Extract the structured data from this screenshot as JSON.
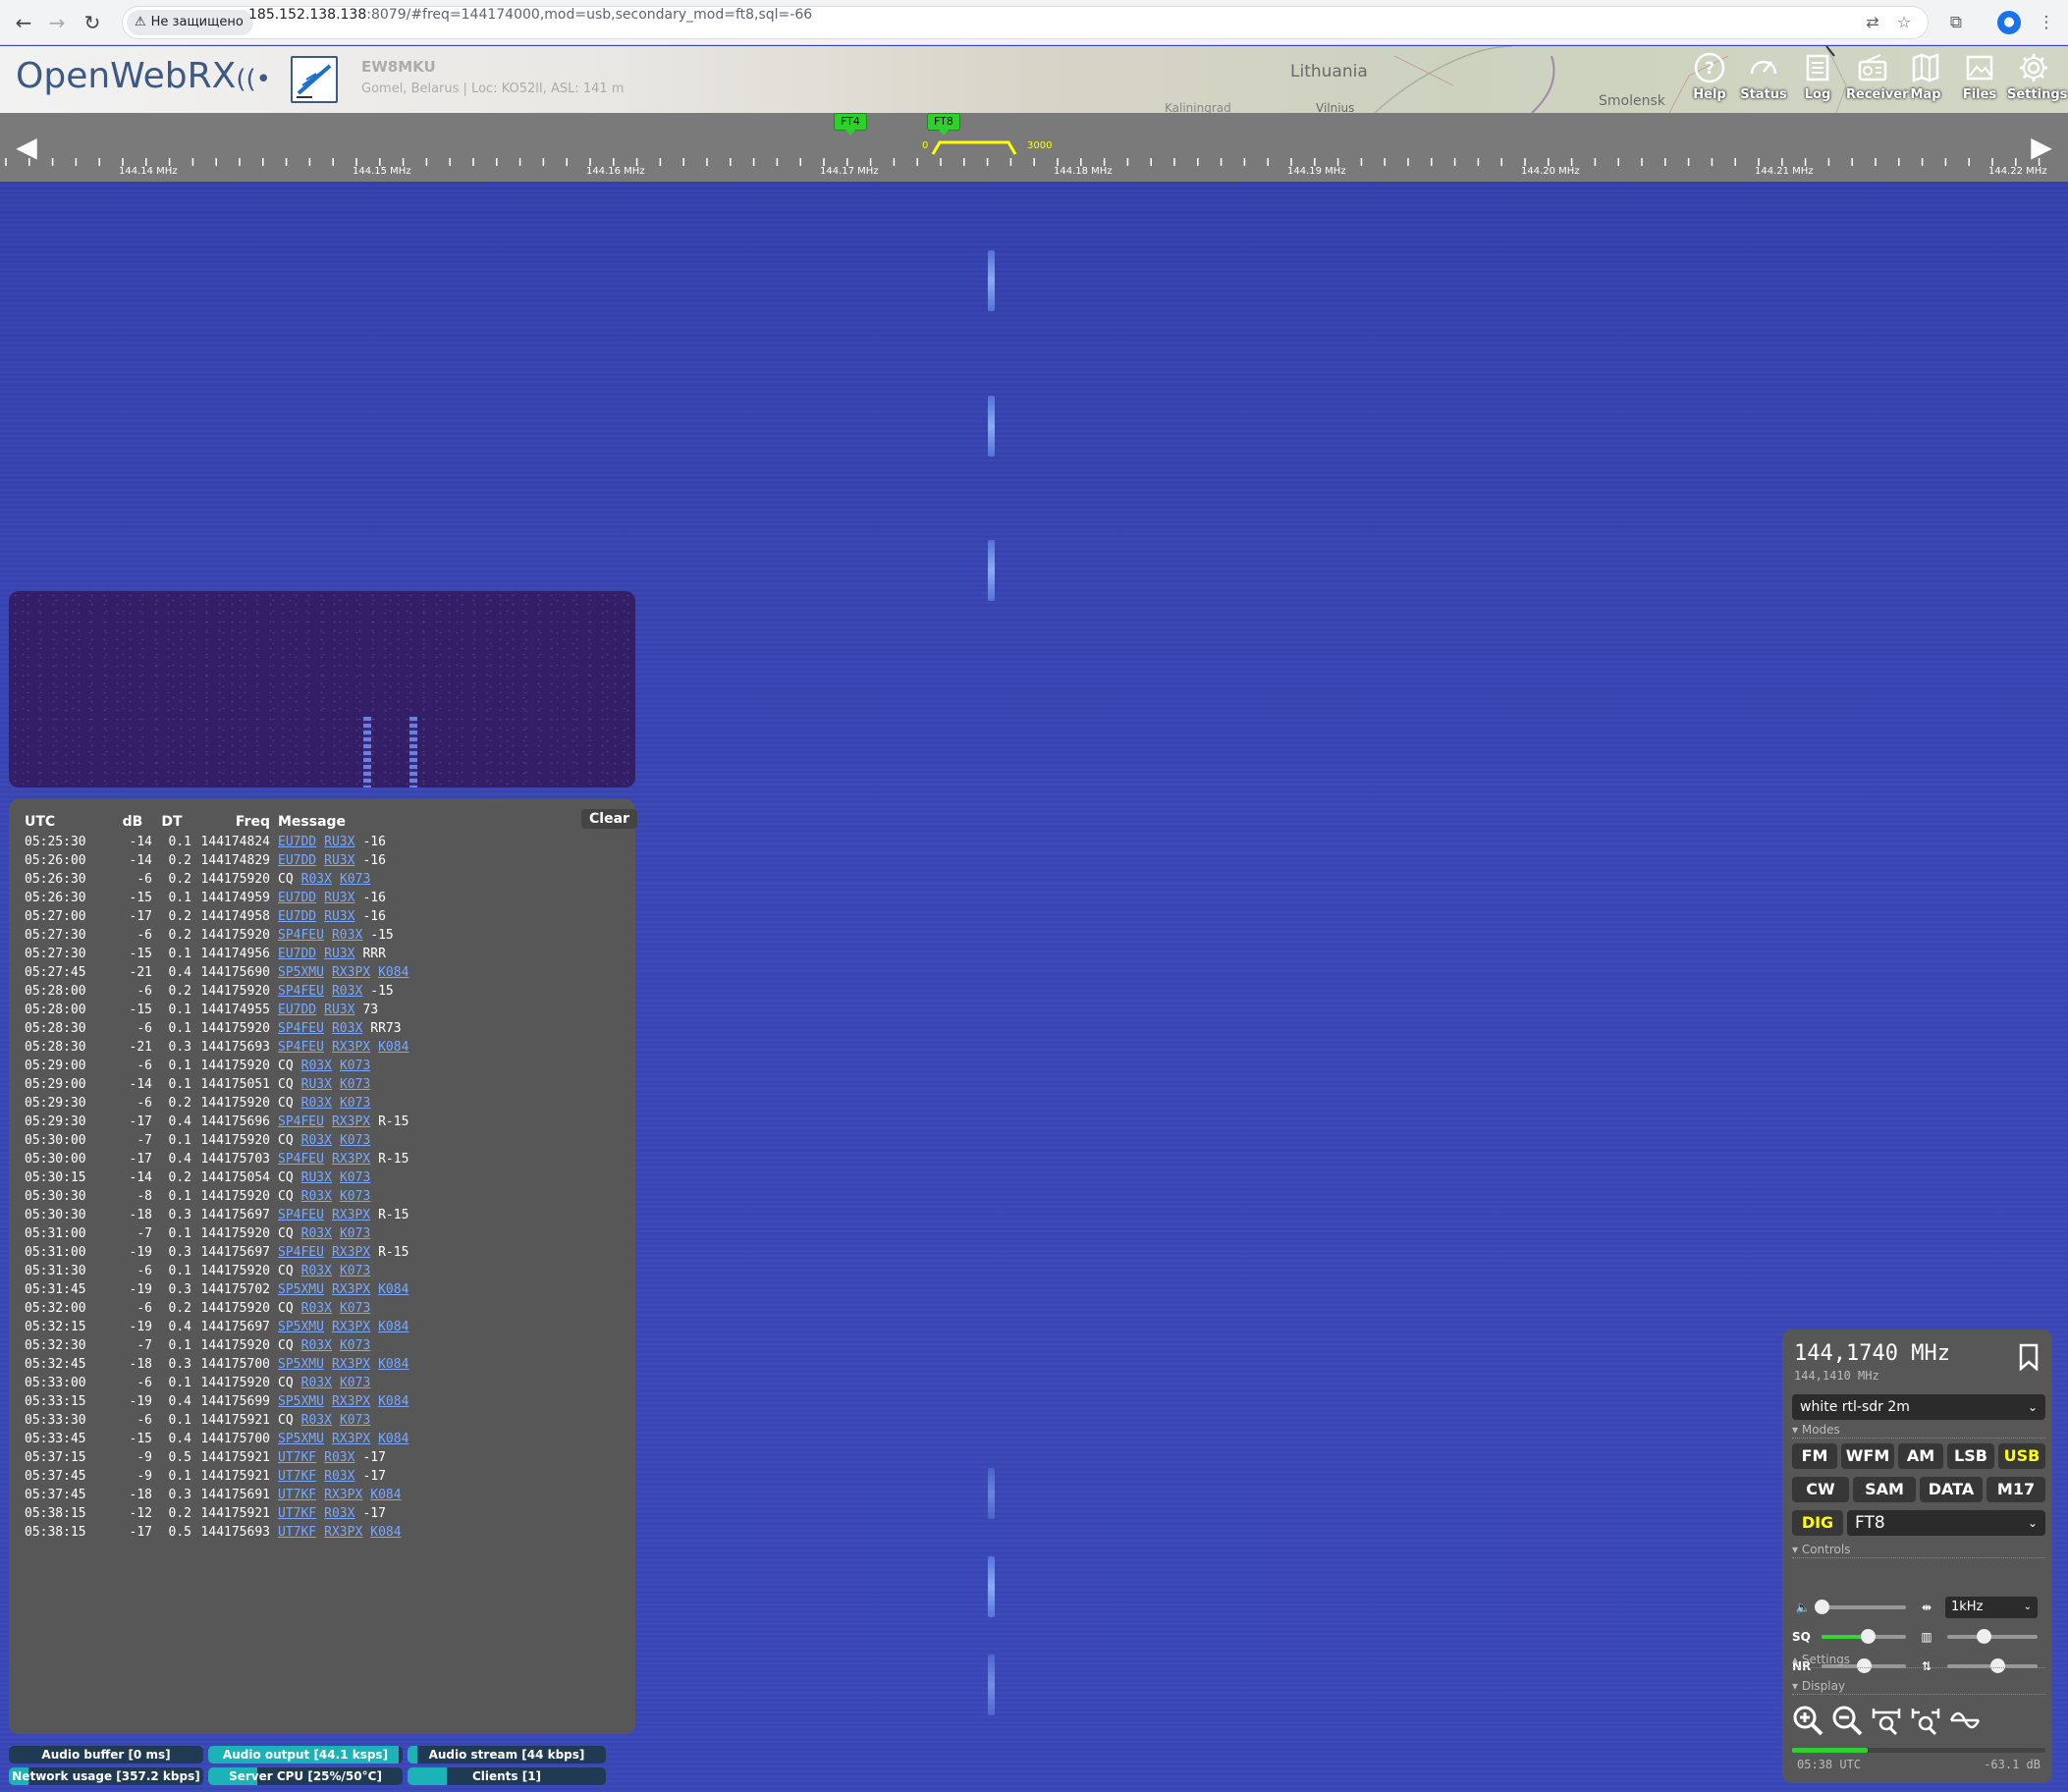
{
  "browser": {
    "security_label": "Не защищено",
    "url_host": "185.152.138.138",
    "url_rest": ":8079/#freq=144174000,mod=usb,secondary_mod=ft8,sql=-66"
  },
  "header": {
    "logo_text": "OpenWebRX",
    "logo_rx": "RX",
    "callsign": "EW8MKU",
    "location": "Gomel, Belarus | Loc: KO52lI, ASL: 141 m",
    "map_labels": [
      "Lithuania",
      "Smolensk",
      "Vilnius",
      "Kaliningrad"
    ],
    "buttons": [
      {
        "name": "help",
        "label": "Help",
        "icon": "help-icon"
      },
      {
        "name": "status",
        "label": "Status",
        "icon": "gauge-icon"
      },
      {
        "name": "log",
        "label": "Log",
        "icon": "log-icon"
      },
      {
        "name": "receiver",
        "label": "Receiver",
        "icon": "radio-icon"
      },
      {
        "name": "map",
        "label": "Map",
        "icon": "map-icon"
      },
      {
        "name": "files",
        "label": "Files",
        "icon": "image-icon"
      },
      {
        "name": "settings",
        "label": "Settings",
        "icon": "gear-icon"
      }
    ]
  },
  "scale": {
    "labels": [
      "144.14 MHz",
      "144.15 MHz",
      "144.16 MHz",
      "144.17 MHz",
      "144.18 MHz",
      "144.19 MHz",
      "144.20 MHz",
      "144.21 MHz",
      "144.22 MHz"
    ],
    "bookmarks": [
      "FT4",
      "FT8"
    ],
    "bw_low": "0",
    "bw_high": "3000",
    "colors": {
      "bookmark": "#2cd12c",
      "passband": "#ffff00"
    }
  },
  "log": {
    "clear_label": "Clear",
    "headers": {
      "utc": "UTC",
      "db": "dB",
      "dt": "DT",
      "freq": "Freq",
      "message": "Message"
    },
    "rows": [
      {
        "utc": "05:25:30",
        "db": "-14",
        "dt": "0.1",
        "freq": "144174824",
        "msg": [
          {
            "t": "EU7DD",
            "l": true
          },
          {
            "t": "RU3X",
            "l": true
          },
          {
            "t": "-16",
            "l": false
          }
        ]
      },
      {
        "utc": "05:26:00",
        "db": "-14",
        "dt": "0.2",
        "freq": "144174829",
        "msg": [
          {
            "t": "EU7DD",
            "l": true
          },
          {
            "t": "RU3X",
            "l": true
          },
          {
            "t": "-16",
            "l": false
          }
        ]
      },
      {
        "utc": "05:26:30",
        "db": "-6",
        "dt": "0.2",
        "freq": "144175920",
        "msg": [
          {
            "t": "CQ",
            "l": false
          },
          {
            "t": "R03X",
            "l": true
          },
          {
            "t": "K073",
            "l": true
          }
        ]
      },
      {
        "utc": "05:26:30",
        "db": "-15",
        "dt": "0.1",
        "freq": "144174959",
        "msg": [
          {
            "t": "EU7DD",
            "l": true
          },
          {
            "t": "RU3X",
            "l": true
          },
          {
            "t": "-16",
            "l": false
          }
        ]
      },
      {
        "utc": "05:27:00",
        "db": "-17",
        "dt": "0.2",
        "freq": "144174958",
        "msg": [
          {
            "t": "EU7DD",
            "l": true
          },
          {
            "t": "RU3X",
            "l": true
          },
          {
            "t": "-16",
            "l": false
          }
        ]
      },
      {
        "utc": "05:27:30",
        "db": "-6",
        "dt": "0.2",
        "freq": "144175920",
        "msg": [
          {
            "t": "SP4FEU",
            "l": true
          },
          {
            "t": "R03X",
            "l": true
          },
          {
            "t": "-15",
            "l": false
          }
        ]
      },
      {
        "utc": "05:27:30",
        "db": "-15",
        "dt": "0.1",
        "freq": "144174956",
        "msg": [
          {
            "t": "EU7DD",
            "l": true
          },
          {
            "t": "RU3X",
            "l": true
          },
          {
            "t": "RRR",
            "l": false
          }
        ]
      },
      {
        "utc": "05:27:45",
        "db": "-21",
        "dt": "0.4",
        "freq": "144175690",
        "msg": [
          {
            "t": "SP5XMU",
            "l": true
          },
          {
            "t": "RX3PX",
            "l": true
          },
          {
            "t": "K084",
            "l": true
          }
        ]
      },
      {
        "utc": "05:28:00",
        "db": "-6",
        "dt": "0.2",
        "freq": "144175920",
        "msg": [
          {
            "t": "SP4FEU",
            "l": true
          },
          {
            "t": "R03X",
            "l": true
          },
          {
            "t": "-15",
            "l": false
          }
        ]
      },
      {
        "utc": "05:28:00",
        "db": "-15",
        "dt": "0.1",
        "freq": "144174955",
        "msg": [
          {
            "t": "EU7DD",
            "l": true
          },
          {
            "t": "RU3X",
            "l": true
          },
          {
            "t": "73",
            "l": false
          }
        ]
      },
      {
        "utc": "05:28:30",
        "db": "-6",
        "dt": "0.1",
        "freq": "144175920",
        "msg": [
          {
            "t": "SP4FEU",
            "l": true
          },
          {
            "t": "R03X",
            "l": true
          },
          {
            "t": "RR73",
            "l": false
          }
        ]
      },
      {
        "utc": "05:28:30",
        "db": "-21",
        "dt": "0.3",
        "freq": "144175693",
        "msg": [
          {
            "t": "SP4FEU",
            "l": true
          },
          {
            "t": "RX3PX",
            "l": true
          },
          {
            "t": "K084",
            "l": true
          }
        ]
      },
      {
        "utc": "05:29:00",
        "db": "-6",
        "dt": "0.1",
        "freq": "144175920",
        "msg": [
          {
            "t": "CQ",
            "l": false
          },
          {
            "t": "R03X",
            "l": true
          },
          {
            "t": "K073",
            "l": true
          }
        ]
      },
      {
        "utc": "05:29:00",
        "db": "-14",
        "dt": "0.1",
        "freq": "144175051",
        "msg": [
          {
            "t": "CQ",
            "l": false
          },
          {
            "t": "RU3X",
            "l": true
          },
          {
            "t": "K073",
            "l": true
          }
        ]
      },
      {
        "utc": "05:29:30",
        "db": "-6",
        "dt": "0.2",
        "freq": "144175920",
        "msg": [
          {
            "t": "CQ",
            "l": false
          },
          {
            "t": "R03X",
            "l": true
          },
          {
            "t": "K073",
            "l": true
          }
        ]
      },
      {
        "utc": "05:29:30",
        "db": "-17",
        "dt": "0.4",
        "freq": "144175696",
        "msg": [
          {
            "t": "SP4FEU",
            "l": true
          },
          {
            "t": "RX3PX",
            "l": true
          },
          {
            "t": "R-15",
            "l": false
          }
        ]
      },
      {
        "utc": "05:30:00",
        "db": "-7",
        "dt": "0.1",
        "freq": "144175920",
        "msg": [
          {
            "t": "CQ",
            "l": false
          },
          {
            "t": "R03X",
            "l": true
          },
          {
            "t": "K073",
            "l": true
          }
        ]
      },
      {
        "utc": "05:30:00",
        "db": "-17",
        "dt": "0.4",
        "freq": "144175703",
        "msg": [
          {
            "t": "SP4FEU",
            "l": true
          },
          {
            "t": "RX3PX",
            "l": true
          },
          {
            "t": "R-15",
            "l": false
          }
        ]
      },
      {
        "utc": "05:30:15",
        "db": "-14",
        "dt": "0.2",
        "freq": "144175054",
        "msg": [
          {
            "t": "CQ",
            "l": false
          },
          {
            "t": "RU3X",
            "l": true
          },
          {
            "t": "K073",
            "l": true
          }
        ]
      },
      {
        "utc": "05:30:30",
        "db": "-8",
        "dt": "0.1",
        "freq": "144175920",
        "msg": [
          {
            "t": "CQ",
            "l": false
          },
          {
            "t": "R03X",
            "l": true
          },
          {
            "t": "K073",
            "l": true
          }
        ]
      },
      {
        "utc": "05:30:30",
        "db": "-18",
        "dt": "0.3",
        "freq": "144175697",
        "msg": [
          {
            "t": "SP4FEU",
            "l": true
          },
          {
            "t": "RX3PX",
            "l": true
          },
          {
            "t": "R-15",
            "l": false
          }
        ]
      },
      {
        "utc": "05:31:00",
        "db": "-7",
        "dt": "0.1",
        "freq": "144175920",
        "msg": [
          {
            "t": "CQ",
            "l": false
          },
          {
            "t": "R03X",
            "l": true
          },
          {
            "t": "K073",
            "l": true
          }
        ]
      },
      {
        "utc": "05:31:00",
        "db": "-19",
        "dt": "0.3",
        "freq": "144175697",
        "msg": [
          {
            "t": "SP4FEU",
            "l": true
          },
          {
            "t": "RX3PX",
            "l": true
          },
          {
            "t": "R-15",
            "l": false
          }
        ]
      },
      {
        "utc": "05:31:30",
        "db": "-6",
        "dt": "0.1",
        "freq": "144175920",
        "msg": [
          {
            "t": "CQ",
            "l": false
          },
          {
            "t": "R03X",
            "l": true
          },
          {
            "t": "K073",
            "l": true
          }
        ]
      },
      {
        "utc": "05:31:45",
        "db": "-19",
        "dt": "0.3",
        "freq": "144175702",
        "msg": [
          {
            "t": "SP5XMU",
            "l": true
          },
          {
            "t": "RX3PX",
            "l": true
          },
          {
            "t": "K084",
            "l": true
          }
        ]
      },
      {
        "utc": "05:32:00",
        "db": "-6",
        "dt": "0.2",
        "freq": "144175920",
        "msg": [
          {
            "t": "CQ",
            "l": false
          },
          {
            "t": "R03X",
            "l": true
          },
          {
            "t": "K073",
            "l": true
          }
        ]
      },
      {
        "utc": "05:32:15",
        "db": "-19",
        "dt": "0.4",
        "freq": "144175697",
        "msg": [
          {
            "t": "SP5XMU",
            "l": true
          },
          {
            "t": "RX3PX",
            "l": true
          },
          {
            "t": "K084",
            "l": true
          }
        ]
      },
      {
        "utc": "05:32:30",
        "db": "-7",
        "dt": "0.1",
        "freq": "144175920",
        "msg": [
          {
            "t": "CQ",
            "l": false
          },
          {
            "t": "R03X",
            "l": true
          },
          {
            "t": "K073",
            "l": true
          }
        ]
      },
      {
        "utc": "05:32:45",
        "db": "-18",
        "dt": "0.3",
        "freq": "144175700",
        "msg": [
          {
            "t": "SP5XMU",
            "l": true
          },
          {
            "t": "RX3PX",
            "l": true
          },
          {
            "t": "K084",
            "l": true
          }
        ]
      },
      {
        "utc": "05:33:00",
        "db": "-6",
        "dt": "0.1",
        "freq": "144175920",
        "msg": [
          {
            "t": "CQ",
            "l": false
          },
          {
            "t": "R03X",
            "l": true
          },
          {
            "t": "K073",
            "l": true
          }
        ]
      },
      {
        "utc": "05:33:15",
        "db": "-19",
        "dt": "0.4",
        "freq": "144175699",
        "msg": [
          {
            "t": "SP5XMU",
            "l": true
          },
          {
            "t": "RX3PX",
            "l": true
          },
          {
            "t": "K084",
            "l": true
          }
        ]
      },
      {
        "utc": "05:33:30",
        "db": "-6",
        "dt": "0.1",
        "freq": "144175921",
        "msg": [
          {
            "t": "CQ",
            "l": false
          },
          {
            "t": "R03X",
            "l": true
          },
          {
            "t": "K073",
            "l": true
          }
        ]
      },
      {
        "utc": "05:33:45",
        "db": "-15",
        "dt": "0.4",
        "freq": "144175700",
        "msg": [
          {
            "t": "SP5XMU",
            "l": true
          },
          {
            "t": "RX3PX",
            "l": true
          },
          {
            "t": "K084",
            "l": true
          }
        ]
      },
      {
        "utc": "05:37:15",
        "db": "-9",
        "dt": "0.5",
        "freq": "144175921",
        "msg": [
          {
            "t": "UT7KF",
            "l": true
          },
          {
            "t": "R03X",
            "l": true
          },
          {
            "t": "-17",
            "l": false
          }
        ]
      },
      {
        "utc": "05:37:45",
        "db": "-9",
        "dt": "0.1",
        "freq": "144175921",
        "msg": [
          {
            "t": "UT7KF",
            "l": true
          },
          {
            "t": "R03X",
            "l": true
          },
          {
            "t": "-17",
            "l": false
          }
        ]
      },
      {
        "utc": "05:37:45",
        "db": "-18",
        "dt": "0.3",
        "freq": "144175691",
        "msg": [
          {
            "t": "UT7KF",
            "l": true
          },
          {
            "t": "RX3PX",
            "l": true
          },
          {
            "t": "K084",
            "l": true
          }
        ]
      },
      {
        "utc": "05:38:15",
        "db": "-12",
        "dt": "0.2",
        "freq": "144175921",
        "msg": [
          {
            "t": "UT7KF",
            "l": true
          },
          {
            "t": "R03X",
            "l": true
          },
          {
            "t": "-17",
            "l": false
          }
        ]
      },
      {
        "utc": "05:38:15",
        "db": "-17",
        "dt": "0.5",
        "freq": "144175693",
        "msg": [
          {
            "t": "UT7KF",
            "l": true
          },
          {
            "t": "RX3PX",
            "l": true
          },
          {
            "t": "K084",
            "l": true
          }
        ]
      }
    ]
  },
  "status_bars": {
    "audio_buffer": {
      "label": "Audio buffer [0 ms]",
      "level": 0.0
    },
    "audio_output": {
      "label": "Audio output [44.1 ksps]",
      "level": 0.98
    },
    "audio_stream": {
      "label": "Audio stream [44 kbps]",
      "level": 0.05
    },
    "network": {
      "label": "Network usage [357.2 kbps]",
      "level": 0.1
    },
    "server_cpu": {
      "label": "Server CPU [25%/50°C]",
      "level": 0.25
    },
    "clients": {
      "label": "Clients [1]",
      "level": 0.2
    }
  },
  "receiver": {
    "frequency": "144,1740 MHz",
    "center_frequency": "144,1410 MHz",
    "profile": "white rtl-sdr 2m",
    "sections": {
      "modes": "▾ Modes",
      "controls": "▾ Controls",
      "settings": "▴ Settings",
      "display": "▾ Display"
    },
    "modes_row1": [
      "FM",
      "WFM",
      "AM",
      "LSB",
      "USB"
    ],
    "modes_row2": [
      "CW",
      "SAM",
      "DATA",
      "M17"
    ],
    "active_mode": "USB",
    "dig_label": "DIG",
    "dig_mode": "FT8",
    "step": "1kHz",
    "sq_label": "SQ",
    "nr_label": "NR",
    "volume_level": 0.0,
    "squelch_level": 0.55,
    "nr_level": 0.5,
    "gain_level": 0.4,
    "agc_level": 0.55,
    "utc_time": "05:38 UTC",
    "db_level": "-63.1 dB",
    "time_progress": 0.3,
    "active_color": "#ffff00"
  }
}
